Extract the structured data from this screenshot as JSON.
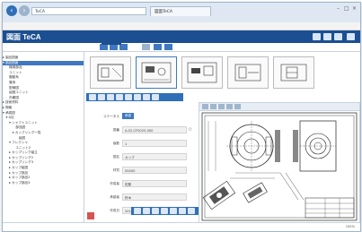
{
  "browser": {
    "url": "TeCA",
    "tab_title": "図面TeCA"
  },
  "app": {
    "logo": "図面 TeCA",
    "brand_color": "#1b4f92",
    "accent_color": "#3f78c0"
  },
  "tree": {
    "items": [
      {
        "label": "▸ 製品図面",
        "selected": false
      },
      {
        "label": "▾ 部品図面",
        "selected": true
      },
      {
        "label": "　　機械部品",
        "selected": false
      },
      {
        "label": "　　ユニット",
        "selected": false
      },
      {
        "label": "　　駆動系",
        "selected": false
      },
      {
        "label": "　　筐体",
        "selected": false
      },
      {
        "label": "　　配線図",
        "selected": false
      },
      {
        "label": "　　組図ユニット",
        "selected": false
      },
      {
        "label": "　　外観図",
        "selected": false
      },
      {
        "label": "▸ 技術資料",
        "selected": false
      },
      {
        "label": "▸ 規格",
        "selected": false
      },
      {
        "label": "▾ 承認図",
        "selected": false
      },
      {
        "label": "　▾ A社",
        "selected": false
      },
      {
        "label": "　　▾ シャフトユニット",
        "selected": false
      },
      {
        "label": "　　　　部品図",
        "selected": false
      },
      {
        "label": "　　　▾ カップリング一覧",
        "selected": false
      },
      {
        "label": "　　　　　組図",
        "selected": false
      },
      {
        "label": "　　▾ フレクシャ",
        "selected": false
      },
      {
        "label": "　　　　ユニット2",
        "selected": false
      },
      {
        "label": "　　▸ カップリング組立",
        "selected": false
      },
      {
        "label": "　　▸ カップリング2",
        "selected": false
      },
      {
        "label": "　　▸ カップリング3",
        "selected": false
      },
      {
        "label": "　　▸ カップ組図",
        "selected": false
      },
      {
        "label": "　　▸ カップ部品",
        "selected": false
      },
      {
        "label": "　　▸ カップ部品2",
        "selected": false
      },
      {
        "label": "　　▸ カップ部品3",
        "selected": false
      }
    ]
  },
  "properties": {
    "rows": [
      {
        "label": "ステータス",
        "value": "承認"
      },
      {
        "label": "図番",
        "value": "A-02-CF0025-000"
      },
      {
        "label": "版数",
        "value": "1"
      },
      {
        "label": "図名",
        "value": "カップ"
      },
      {
        "label": "材質",
        "value": "SS400"
      },
      {
        "label": "作成者",
        "value": "佐藤"
      },
      {
        "label": "承認者",
        "value": "鈴木"
      },
      {
        "label": "作成日",
        "value": "2014"
      },
      {
        "label": "更新日",
        "value": "2015"
      }
    ]
  },
  "footer": {
    "zoom": "100%"
  }
}
